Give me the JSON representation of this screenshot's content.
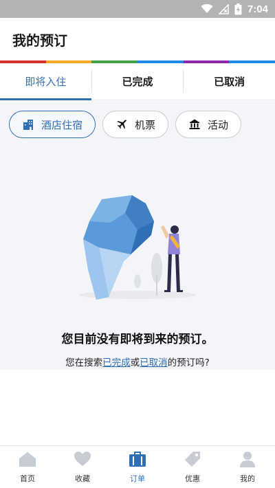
{
  "status_bar": {
    "time": "7:04"
  },
  "header": {
    "title": "我的预订"
  },
  "rainbow_colors": [
    "#d32f2f",
    "#f5a623",
    "#43a047",
    "#1e88e5",
    "#8e24aa",
    "#1e88e5"
  ],
  "tabs": [
    {
      "label": "即将入住",
      "active": true
    },
    {
      "label": "已完成",
      "active": false
    },
    {
      "label": "已取消",
      "active": false
    }
  ],
  "filters": [
    {
      "label": "酒店住宿",
      "icon": "hotel-icon",
      "active": true
    },
    {
      "label": "机票",
      "icon": "airplane-icon",
      "active": false
    },
    {
      "label": "活动",
      "icon": "attraction-icon",
      "active": false
    }
  ],
  "empty_state": {
    "title": "您目前没有即将到来的预订。",
    "prefix": "您在搜索",
    "link_completed": "已完成",
    "middle": "或",
    "link_cancelled": "已取消",
    "suffix": "的预订吗?"
  },
  "bottom_nav": [
    {
      "label": "首页",
      "icon": "home-icon",
      "active": false
    },
    {
      "label": "收藏",
      "icon": "heart-icon",
      "active": false
    },
    {
      "label": "订单",
      "icon": "briefcase-icon",
      "active": true
    },
    {
      "label": "优惠",
      "icon": "tag-icon",
      "active": false
    },
    {
      "label": "我的",
      "icon": "person-icon",
      "active": false
    }
  ],
  "colors": {
    "accent": "#2f6fb6",
    "status_bar": "#b3b3b3",
    "content_bg": "#f4f5f8",
    "inactive_icon": "#c8ccd3"
  }
}
